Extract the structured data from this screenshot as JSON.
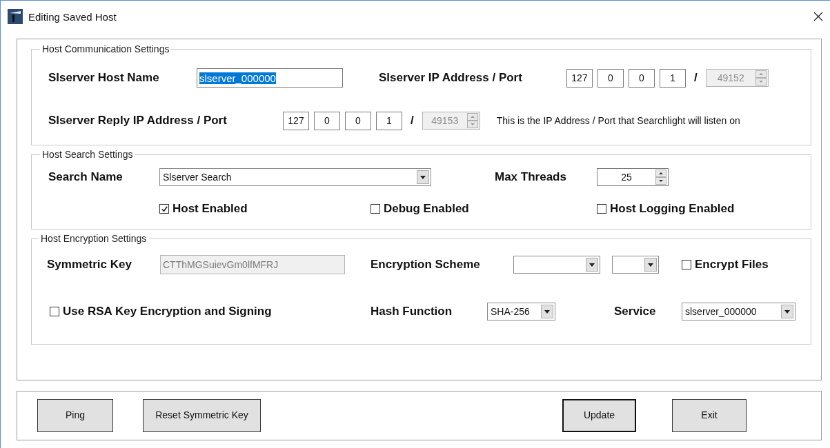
{
  "window": {
    "title": "Editing Saved Host"
  },
  "host_communication": {
    "title": "Host Communication Settings",
    "host_name": {
      "label": "Slserver Host Name",
      "value": "slserver_000000",
      "text_selected": true
    },
    "ip": {
      "label": "Slserver IP Address / Port",
      "octets": [
        "127",
        "0",
        "0",
        "1"
      ],
      "separator": "/",
      "port": "49152",
      "port_disabled": true
    },
    "reply_ip": {
      "label": "Slserver Reply IP Address / Port",
      "octets": [
        "127",
        "0",
        "0",
        "1"
      ],
      "separator": "/",
      "port": "49153",
      "port_disabled": true,
      "note": "This is the IP Address / Port that Searchlight will listen on"
    }
  },
  "host_search": {
    "title": "Host Search Settings",
    "search_name": {
      "label": "Search Name",
      "value": "Slserver Search"
    },
    "max_threads": {
      "label": "Max Threads",
      "value": "25"
    },
    "checkboxes": [
      {
        "label": "Host Enabled",
        "checked": true
      },
      {
        "label": "Debug Enabled",
        "checked": false
      },
      {
        "label": "Host Logging Enabled",
        "checked": false
      }
    ]
  },
  "host_encryption": {
    "title": "Host Encryption Settings",
    "symmetric_key": {
      "label": "Symmetric Key",
      "value": "CTThMGSuievGm0lfMFRJ",
      "disabled": true
    },
    "encryption_scheme": {
      "label": "Encryption Scheme"
    },
    "encrypt_files": {
      "label": "Encrypt Files",
      "checked": false
    },
    "use_rsa": {
      "label": "Use RSA Key Encryption and Signing",
      "checked": false
    },
    "hash_function": {
      "label": "Hash Function",
      "value": "SHA-256"
    },
    "service": {
      "label": "Service",
      "value": "slserver_000000"
    }
  },
  "buttons": [
    {
      "label": "Ping",
      "default": false
    },
    {
      "label": "Reset Symmetric Key",
      "default": false
    },
    {
      "label": "Update",
      "default": true
    },
    {
      "label": "Exit",
      "default": false
    }
  ]
}
